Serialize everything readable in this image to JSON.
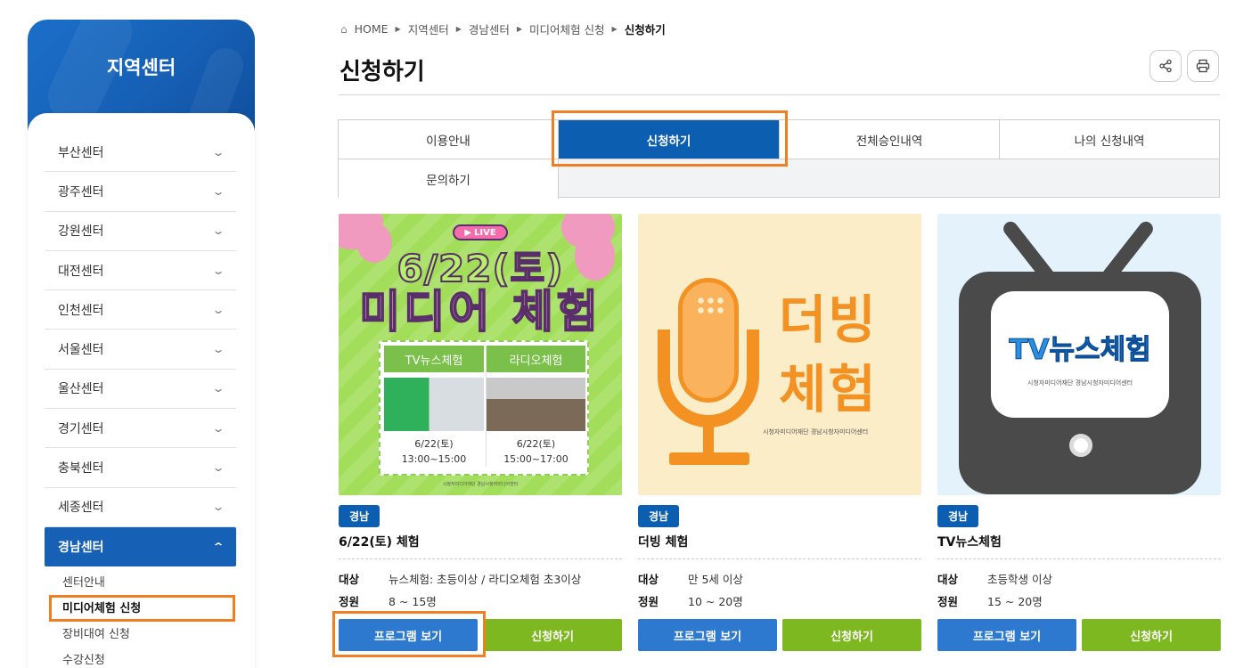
{
  "sidebar": {
    "title": "지역센터",
    "items": [
      {
        "label": "부산센터"
      },
      {
        "label": "광주센터"
      },
      {
        "label": "강원센터"
      },
      {
        "label": "대전센터"
      },
      {
        "label": "인천센터"
      },
      {
        "label": "서울센터"
      },
      {
        "label": "울산센터"
      },
      {
        "label": "경기센터"
      },
      {
        "label": "충북센터"
      },
      {
        "label": "세종센터"
      },
      {
        "label": "경남센터",
        "active": true
      }
    ],
    "sub_items": [
      {
        "label": "센터안내"
      },
      {
        "label": "미디어체험 신청",
        "current": true
      },
      {
        "label": "장비대여 신청"
      },
      {
        "label": "수강신청"
      }
    ]
  },
  "breadcrumb": [
    "HOME",
    "지역센터",
    "경남센터",
    "미디어체험 신청",
    "신청하기"
  ],
  "page_title": "신청하기",
  "toolbar": {
    "share_icon": "share-icon",
    "print_icon": "print-icon"
  },
  "tabs": [
    "이용안내",
    "신청하기",
    "전체승인내역",
    "나의 신청내역",
    "문의하기"
  ],
  "active_tab": "신청하기",
  "thumb1": {
    "live": "LIVE",
    "date": "6/22(토)",
    "headline": "미디어 체험",
    "col1": {
      "label": "TV뉴스체험",
      "date": "6/22(토)",
      "time": "13:00~15:00"
    },
    "col2": {
      "label": "라디오체험",
      "date": "6/22(토)",
      "time": "15:00~17:00"
    }
  },
  "thumb2": {
    "line1": "더빙",
    "line2": "체험"
  },
  "thumb3": {
    "screen": "TV뉴스체험",
    "logo": "시청자미디어재단 경남시청자미디어센터"
  },
  "cards": [
    {
      "badge": "경남",
      "title": "6/22(토) 체험",
      "target_label": "대상",
      "target": "뉴스체험: 초등이상 / 라디오체험 초3이상",
      "capacity_label": "정원",
      "capacity": "8 ~ 15명",
      "view": "프로그램 보기",
      "apply": "신청하기"
    },
    {
      "badge": "경남",
      "title": "더빙 체험",
      "target_label": "대상",
      "target": "만 5세 이상",
      "capacity_label": "정원",
      "capacity": "10 ~ 20명",
      "view": "프로그램 보기",
      "apply": "신청하기"
    },
    {
      "badge": "경남",
      "title": "TV뉴스체험",
      "target_label": "대상",
      "target": "초등학생 이상",
      "capacity_label": "정원",
      "capacity": "15 ~ 20명",
      "view": "프로그램 보기",
      "apply": "신청하기"
    }
  ],
  "colors": {
    "primary": "#0c5fb0",
    "apply_green": "#7db821",
    "view_blue": "#2d79cf",
    "highlight": "#f07f24"
  }
}
